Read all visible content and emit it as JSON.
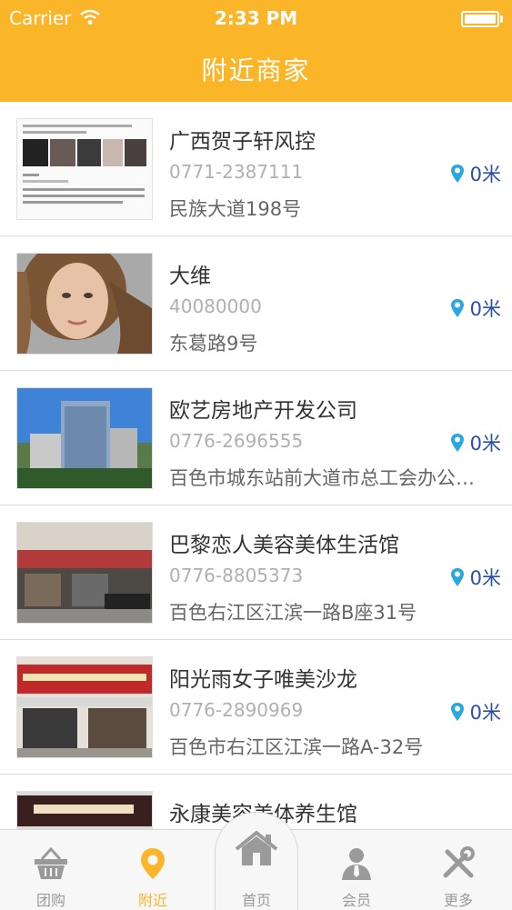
{
  "status": {
    "carrier": "Carrier",
    "time": "2:33 PM"
  },
  "header": {
    "title": "附近商家"
  },
  "merchants": [
    {
      "name": "广西贺子轩风控",
      "phone": "0771-2387111",
      "address": "民族大道198号",
      "distance": "0米",
      "thumb": "news-article-image"
    },
    {
      "name": "大维",
      "phone": "40080000",
      "address": "东葛路9号",
      "distance": "0米",
      "thumb": "girl-portrait-image"
    },
    {
      "name": "欧艺房地产开发公司",
      "phone": "0776-2696555",
      "address": "百色市城东站前大道市总工会办公…",
      "distance": "0米",
      "thumb": "office-building-image"
    },
    {
      "name": "巴黎恋人美容美体生活馆",
      "phone": "0776-8805373",
      "address": "百色右江区江滨一路B座31号",
      "distance": "0米",
      "thumb": "storefront-image"
    },
    {
      "name": "阳光雨女子唯美沙龙",
      "phone": "0776-2890969",
      "address": "百色市右江区江滨一路A-32号",
      "distance": "0米",
      "thumb": "salon-storefront-image"
    },
    {
      "name": "永康美容美体养生馆",
      "phone": "",
      "address": "",
      "distance": "",
      "thumb": "spa-storefront-image"
    }
  ],
  "tabs": [
    {
      "label": "团购",
      "icon": "basket-icon"
    },
    {
      "label": "附近",
      "icon": "location-pin-icon"
    },
    {
      "label": "首页",
      "icon": "home-icon"
    },
    {
      "label": "会员",
      "icon": "member-icon"
    },
    {
      "label": "更多",
      "icon": "tools-icon"
    }
  ],
  "colors": {
    "accent": "#fbb528",
    "distance": "#2a4fa8",
    "pin": "#29a8e0"
  }
}
